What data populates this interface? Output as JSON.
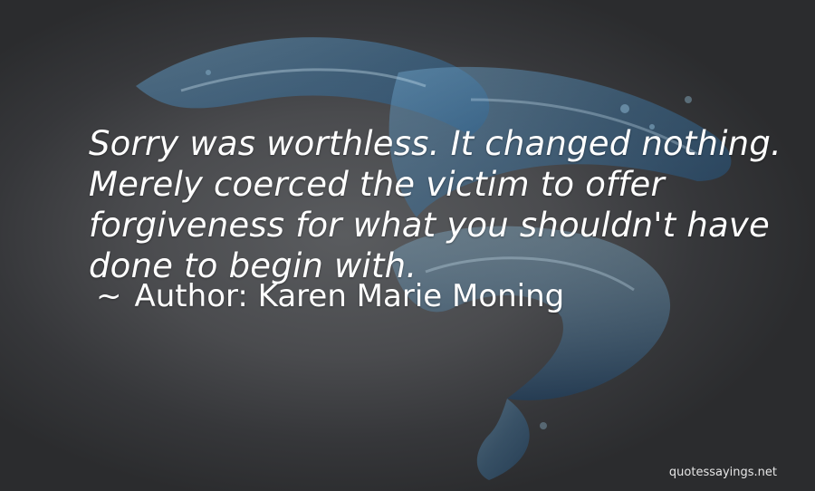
{
  "quote": {
    "lines": [
      "Sorry was worthless. It changed nothing.",
      "Merely coerced the victim to offer",
      "forgiveness for what you shouldn't have",
      "done to begin with."
    ]
  },
  "author": {
    "dash": "~",
    "text": "Author: Karen Marie Moning"
  },
  "watermark": "quotessayings.net",
  "colors": {
    "background": "#3a3b3d",
    "text": "#ffffff",
    "water": "#4f86b0"
  },
  "background_image": "water-splash"
}
